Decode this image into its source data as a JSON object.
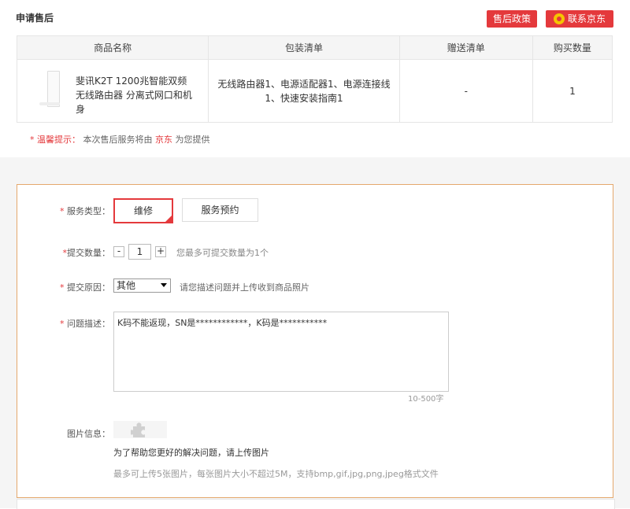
{
  "header": {
    "title": "申请售后",
    "policy_button": "售后政策",
    "contact_button": "联系京东"
  },
  "table": {
    "headers": [
      "商品名称",
      "包装清单",
      "赠送清单",
      "购买数量"
    ],
    "row": {
      "product_name": "斐讯K2T 1200兆智能双频无线路由器 分离式网口和机身",
      "package_list": "无线路由器1、电源适配器1、电源连接线1、快速安装指南1",
      "gift_list": "-",
      "quantity": "1"
    }
  },
  "tip": {
    "star": "*",
    "label": "温馨提示：",
    "text_before": "本次售后服务将由",
    "vendor": "京东",
    "text_after": "为您提供"
  },
  "form": {
    "service_type": {
      "label": "服务类型：",
      "options": [
        "维修",
        "服务预约"
      ],
      "selected": "维修"
    },
    "quantity": {
      "label": "提交数量：",
      "minus": "-",
      "value": "1",
      "plus": "+",
      "hint": "您最多可提交数量为1个"
    },
    "reason": {
      "label": "提交原因：",
      "selected": "其他",
      "hint": "请您描述问题并上传收到商品照片"
    },
    "description": {
      "label": "问题描述：",
      "value": "K码不能返现，SN是************，K码是***********",
      "counter": "10-500字"
    },
    "images": {
      "label": "图片信息：",
      "hint1": "为了帮助您更好的解决问题，请上传图片",
      "hint2": "最多可上传5张图片，每张图片大小不超过5M，支持bmp,gif,jpg,png,jpeg格式文件"
    },
    "required_mark": "*"
  },
  "colors": {
    "accent": "#e4393c",
    "form_border": "#e4a86d"
  }
}
